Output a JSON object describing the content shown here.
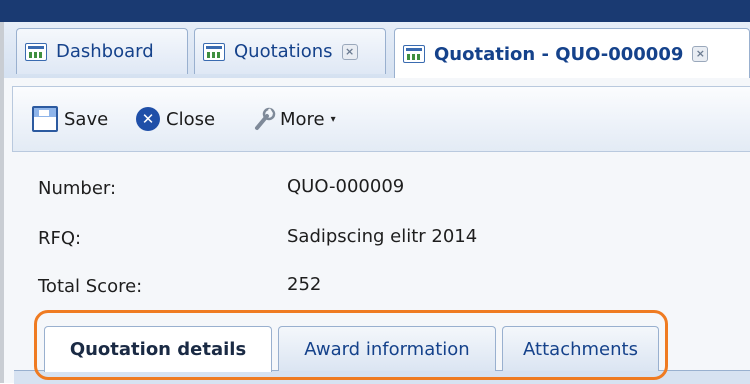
{
  "tabs": [
    {
      "label": "Dashboard",
      "icon": "dashboard-icon",
      "closable": false,
      "active": false
    },
    {
      "label": "Quotations",
      "icon": "grid-icon",
      "closable": true,
      "active": false
    },
    {
      "label": "Quotation - QUO-000009",
      "icon": "grid-icon",
      "closable": true,
      "active": true
    }
  ],
  "tab_close_glyph": "×",
  "toolbar": {
    "save_label": "Save",
    "close_label": "Close",
    "more_label": "More",
    "close_glyph": "✕",
    "caret_glyph": "▾"
  },
  "fields": {
    "number_label": "Number:",
    "number_value": "QUO-000009",
    "rfq_label": "RFQ:",
    "rfq_value": "Sadipscing elitr 2014",
    "total_score_label": "Total Score:",
    "total_score_value": "252"
  },
  "subtabs": [
    {
      "label": "Quotation details",
      "active": true
    },
    {
      "label": "Award information",
      "active": false
    },
    {
      "label": "Attachments",
      "active": false
    }
  ],
  "colors": {
    "topbar": "#1a3a72",
    "tab_text": "#15428b",
    "highlight": "#ef7b22"
  }
}
